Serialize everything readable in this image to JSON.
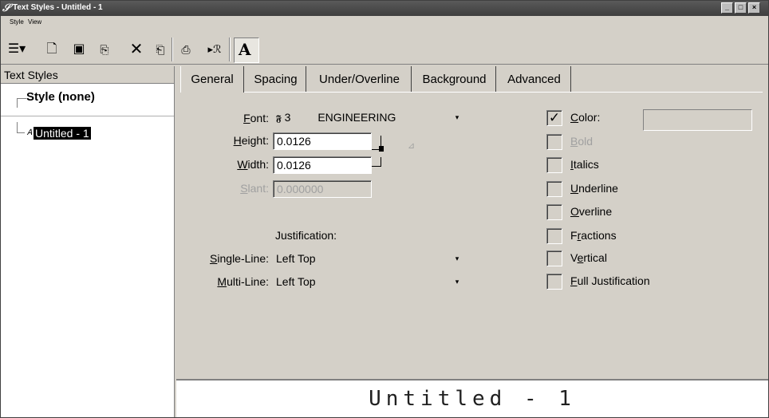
{
  "window": {
    "title": "Text Styles - Untitled - 1"
  },
  "menu": {
    "style": "Style",
    "view": "View"
  },
  "left_panel": {
    "header": "Text Styles",
    "style_none": "Style (none)",
    "selected_item": "Untitled - 1"
  },
  "tabs": [
    "General",
    "Spacing",
    "Under/Overline",
    "Background",
    "Advanced"
  ],
  "general": {
    "font_label": "Font:",
    "font_number": "3",
    "font_name": "ENGINEERING",
    "height_label": "Height:",
    "height_value": "0.0126",
    "width_label": "Width:",
    "width_value": "0.0126",
    "slant_label": "Slant:",
    "slant_value": "0.000000",
    "justification_label": "Justification:",
    "single_line_label": "Single-Line:",
    "single_line_value": "Left Top",
    "multi_line_label": "Multi-Line:",
    "multi_line_value": "Left Top"
  },
  "options": {
    "color": {
      "label": "Color:",
      "checked": true
    },
    "bold": {
      "label": "Bold",
      "checked": false,
      "disabled": true
    },
    "italics": {
      "label": "Italics",
      "checked": false
    },
    "underline": {
      "label": "Underline",
      "checked": false
    },
    "overline": {
      "label": "Overline",
      "checked": false
    },
    "fractions": {
      "label": "Fractions",
      "checked": false
    },
    "vertical": {
      "label": "Vertical",
      "checked": false
    },
    "full_justification": {
      "label": "Full Justification",
      "checked": false
    }
  },
  "preview": {
    "text": "Untitled - 1"
  }
}
